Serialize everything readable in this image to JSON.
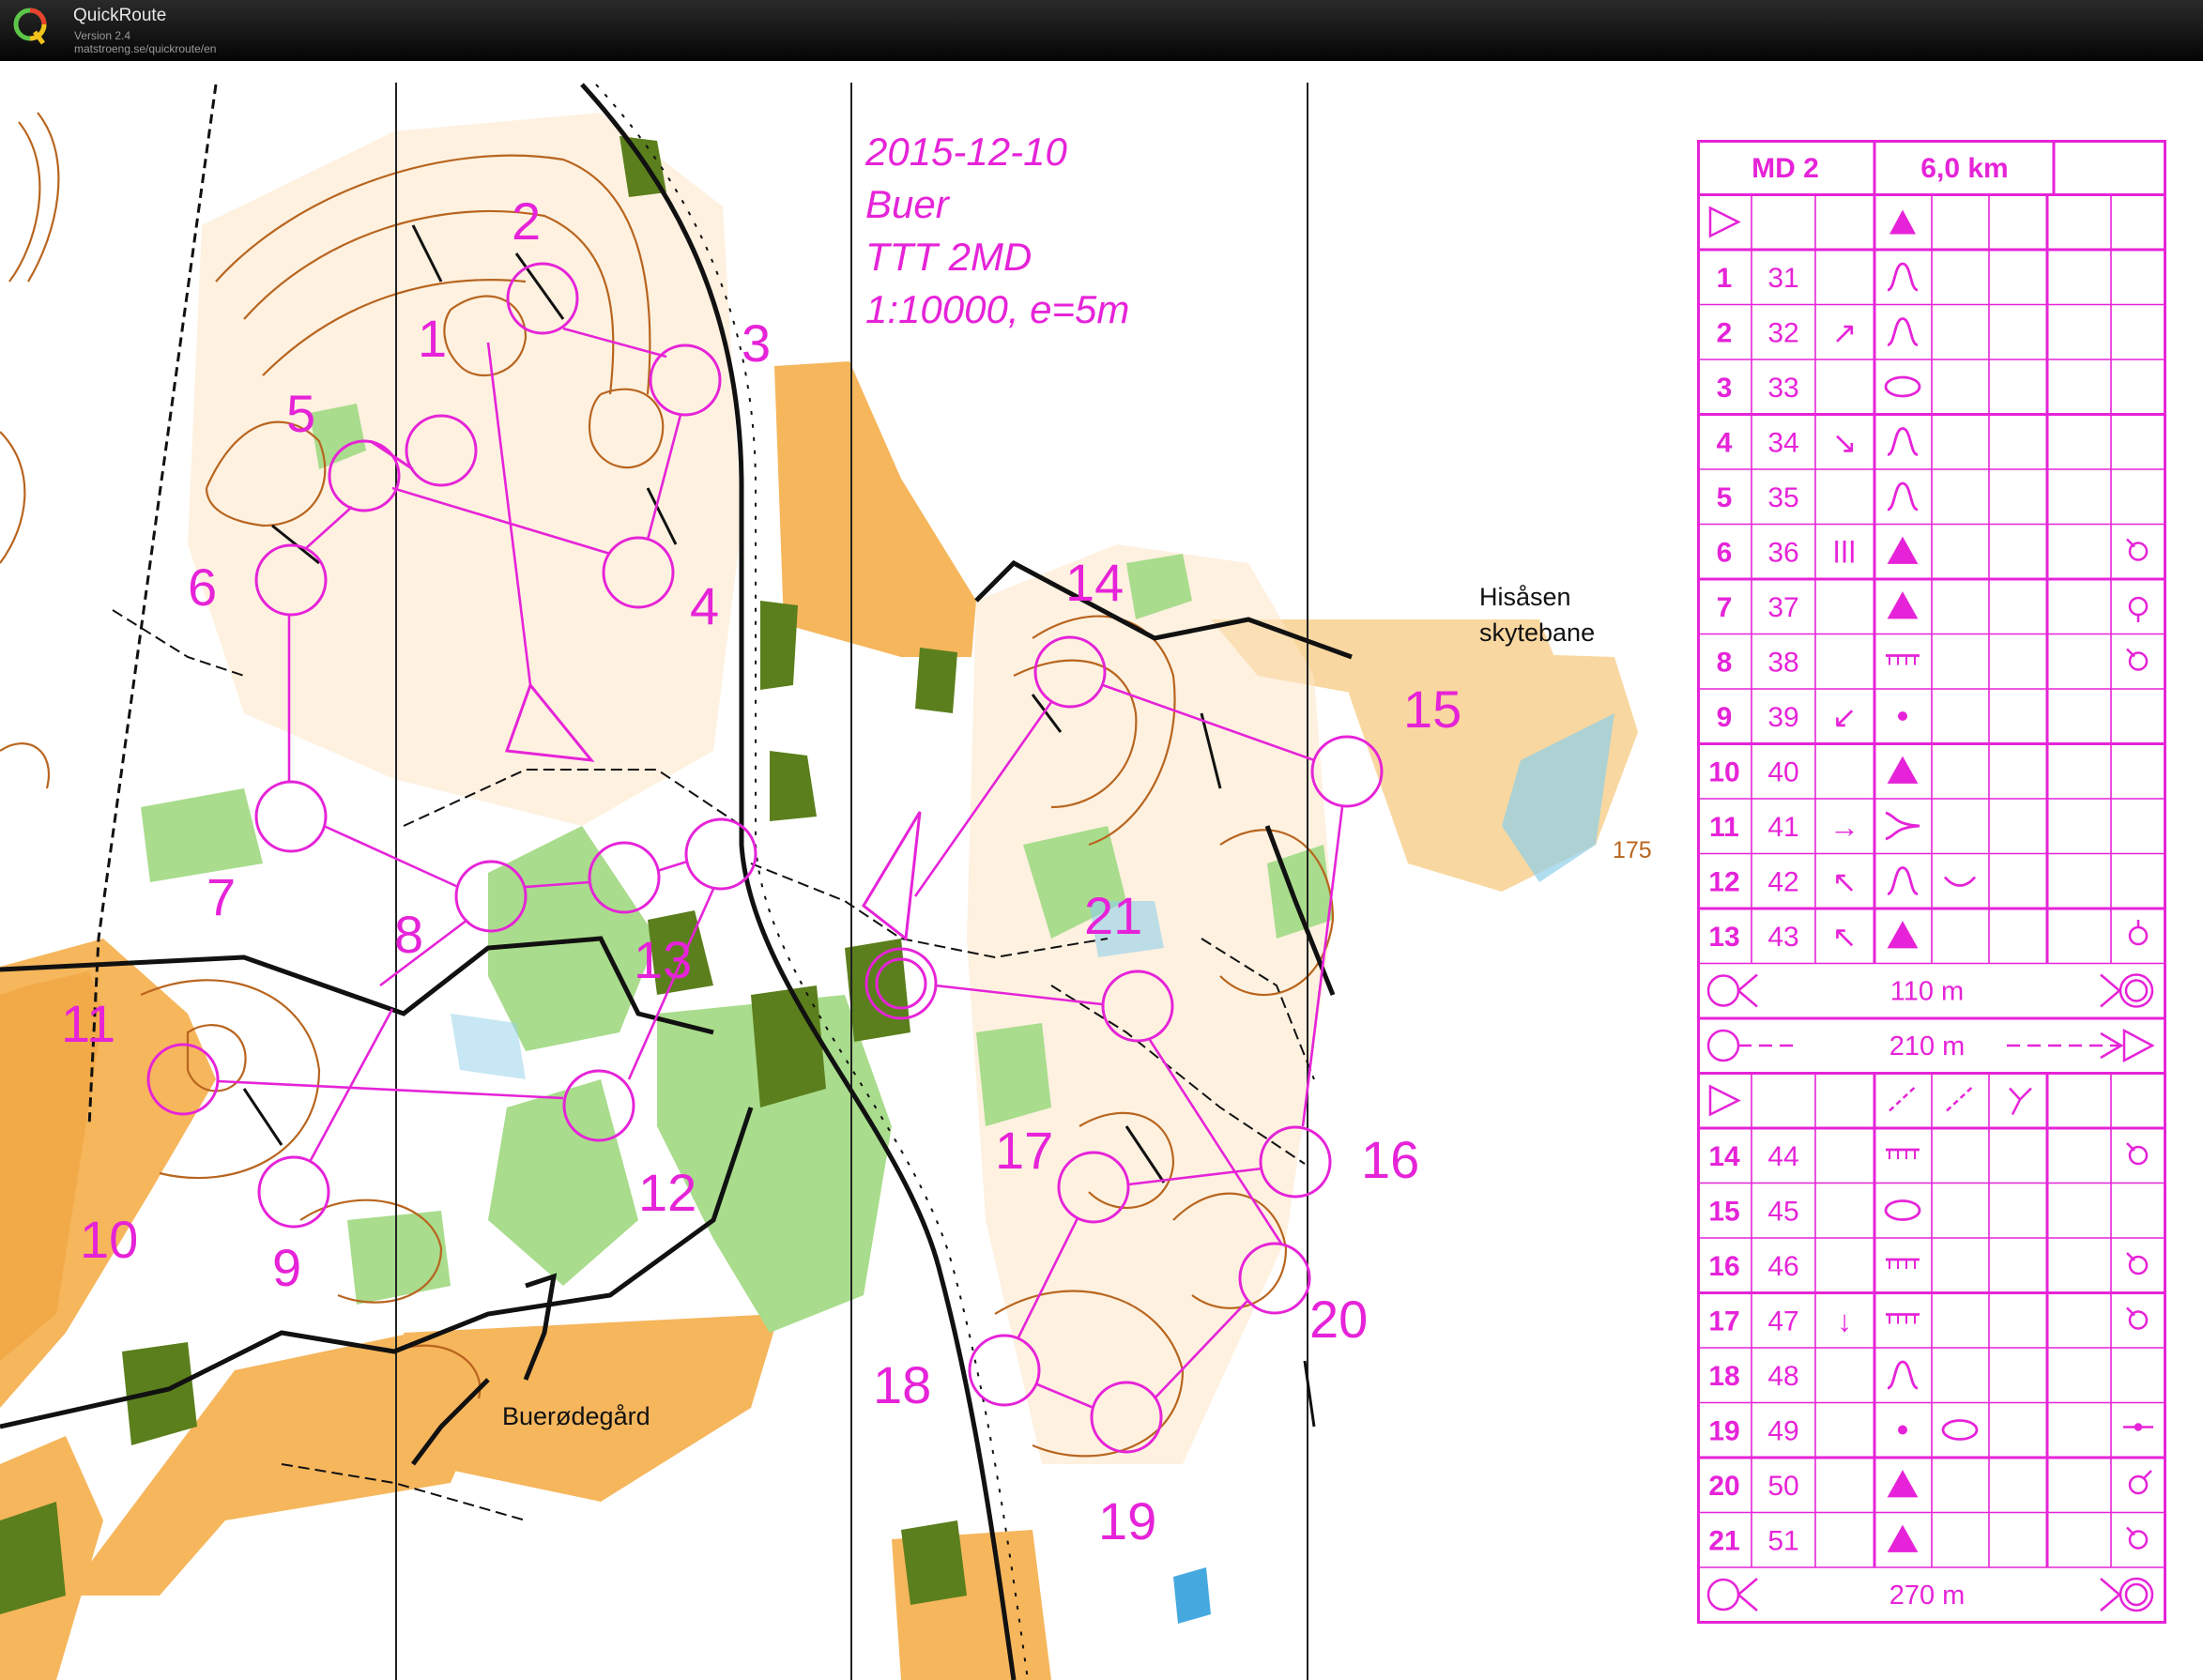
{
  "window": {
    "app_name": "QuickRoute",
    "version": "Version 2.4",
    "url": "matstroeng.se/quickroute/en"
  },
  "map": {
    "header_lines": [
      "2015-12-10",
      "Buer",
      "TTT 2MD",
      "1:10000, e=5m"
    ],
    "place_labels": {
      "hisasen": [
        "Hisåsen",
        "skytebane"
      ],
      "buerodegard": "Buerødegård",
      "spot_height": "175"
    },
    "control_numbers": [
      {
        "n": "1"
      },
      {
        "n": "2"
      },
      {
        "n": "3"
      },
      {
        "n": "4"
      },
      {
        "n": "5"
      },
      {
        "n": "6"
      },
      {
        "n": "7"
      },
      {
        "n": "8"
      },
      {
        "n": "9"
      },
      {
        "n": "10"
      },
      {
        "n": "11"
      },
      {
        "n": "12"
      },
      {
        "n": "13"
      },
      {
        "n": "14"
      },
      {
        "n": "15"
      },
      {
        "n": "16"
      },
      {
        "n": "17"
      },
      {
        "n": "18"
      },
      {
        "n": "19"
      },
      {
        "n": "20"
      },
      {
        "n": "21"
      }
    ],
    "colors": {
      "course": "#e623d8",
      "contour": "#b8651f",
      "open": "#f6b65c",
      "green": "#a9dc8c",
      "dark_green": "#5b7f1c",
      "water": "#8fd0ea",
      "black": "#111111"
    }
  },
  "control_descriptions": {
    "header": {
      "event": "MD 2",
      "length": "6,0 km"
    },
    "section1": [
      {
        "num": "1",
        "code": "31",
        "dir": "",
        "feature": "knoll"
      },
      {
        "num": "2",
        "code": "32",
        "dir": "↗",
        "feature": "knoll"
      },
      {
        "num": "3",
        "code": "33",
        "dir": "",
        "feature": "depression"
      },
      {
        "num": "4",
        "code": "34",
        "dir": "↘",
        "feature": "knoll"
      },
      {
        "num": "5",
        "code": "35",
        "dir": "",
        "feature": "knoll"
      },
      {
        "num": "6",
        "code": "36",
        "dir": "ǀǀǀ",
        "feature": "boulder",
        "loc": "foot-corner"
      },
      {
        "num": "7",
        "code": "37",
        "dir": "",
        "feature": "boulder",
        "loc": "foot-below"
      },
      {
        "num": "8",
        "code": "38",
        "dir": "",
        "feature": "cliff",
        "loc": "foot-corner"
      },
      {
        "num": "9",
        "code": "39",
        "dir": "↙",
        "feature": "point"
      },
      {
        "num": "10",
        "code": "40",
        "dir": "",
        "feature": "boulder"
      },
      {
        "num": "11",
        "code": "41",
        "dir": "→",
        "feature": "spur"
      },
      {
        "num": "12",
        "code": "42",
        "dir": "↖",
        "feature": "knoll",
        "extra": "saddle"
      },
      {
        "num": "13",
        "code": "43",
        "dir": "↖",
        "feature": "boulder",
        "loc": "foot-above"
      }
    ],
    "marked_route_1": "110 m",
    "map_exchange": "210 m",
    "section2": [
      {
        "num": "14",
        "code": "44",
        "dir": "",
        "feature": "cliff",
        "loc": "foot-corner"
      },
      {
        "num": "15",
        "code": "45",
        "dir": "",
        "feature": "depression"
      },
      {
        "num": "16",
        "code": "46",
        "dir": "",
        "feature": "cliff",
        "loc": "foot-corner"
      },
      {
        "num": "17",
        "code": "47",
        "dir": "↓",
        "feature": "cliff",
        "loc": "foot-corner"
      },
      {
        "num": "18",
        "code": "48",
        "dir": "",
        "feature": "knoll"
      },
      {
        "num": "19",
        "code": "49",
        "dir": "",
        "feature": "point",
        "extra": "depression",
        "loc": "between"
      },
      {
        "num": "20",
        "code": "50",
        "dir": "",
        "feature": "boulder",
        "loc": "foot-side"
      },
      {
        "num": "21",
        "code": "51",
        "dir": "",
        "feature": "boulder",
        "loc": "foot-corner"
      }
    ],
    "finish_route": "270 m"
  }
}
